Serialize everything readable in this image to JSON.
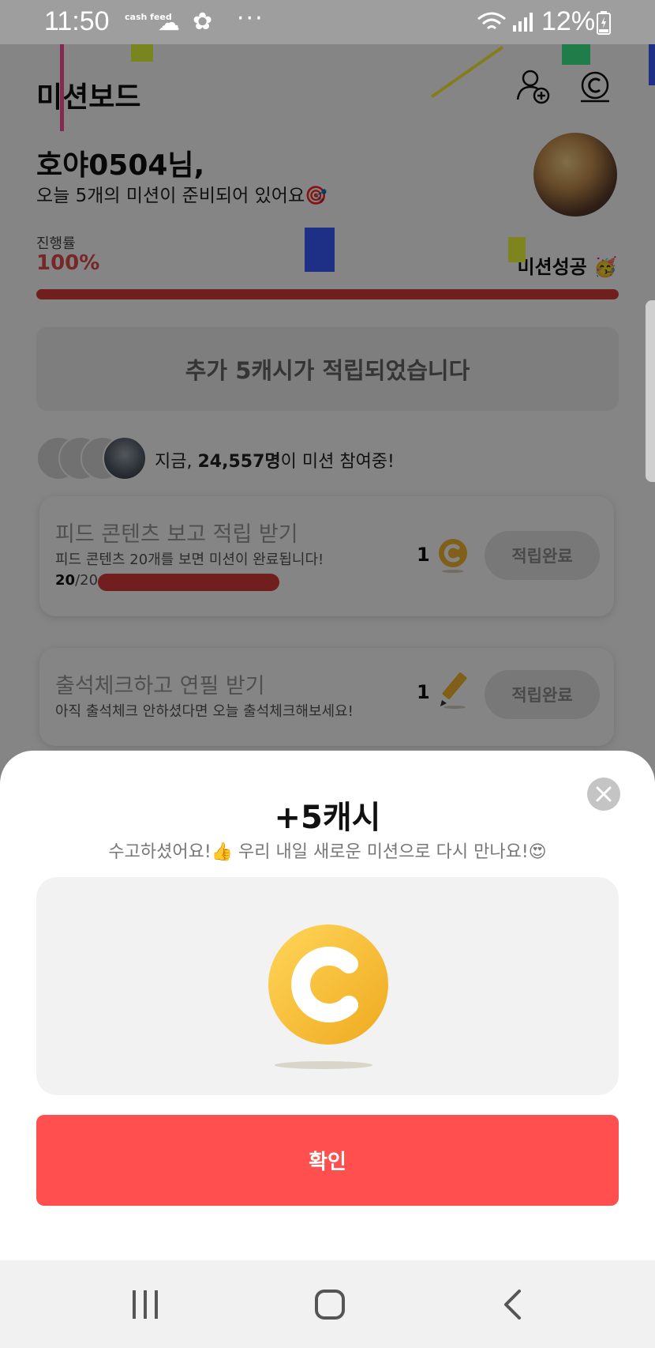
{
  "status_bar": {
    "time": "11:50",
    "app_badge": "cash feed",
    "battery": "12%"
  },
  "header": {
    "title": "미션보드"
  },
  "greeting": {
    "name_line": "호야0504님,",
    "message": "오늘 5개의 미션이 준비되어 있어요🎯"
  },
  "progress": {
    "label": "진행률",
    "value_text": "100%",
    "value": 1.0,
    "status": "미션성공 🥳"
  },
  "banner": {
    "text": "추가 5캐시가 적립되었습니다"
  },
  "participants": {
    "prefix": "지금,",
    "count": "24,557명",
    "suffix": "이 미션 참여중!"
  },
  "missions": [
    {
      "title": "피드 콘텐츠 보고 적립 받기",
      "description": "피드 콘텐츠 20개를 보면 미션이 완료됩니다!",
      "progress_done": "20",
      "progress_total": "/20",
      "reward_count": "1",
      "reward_icon": "cash-coin-icon",
      "button_label": "적립완료"
    },
    {
      "title": "출석체크하고 연필 받기",
      "description": "아직 출석체크 안하셨다면 오늘 출석체크해보세요!",
      "reward_count": "1",
      "reward_icon": "pencil-icon",
      "button_label": "적립완료"
    }
  ],
  "sheet": {
    "title": "+5캐시",
    "subtitle": "수고하셨어요!👍 우리 내일 새로운 미션으로 다시 만나요!😍",
    "confirm_label": "확인"
  },
  "colors": {
    "accent_red": "#ff4f4f",
    "progress_red": "#d63b3b",
    "coin_gold": "#f5b82e"
  }
}
